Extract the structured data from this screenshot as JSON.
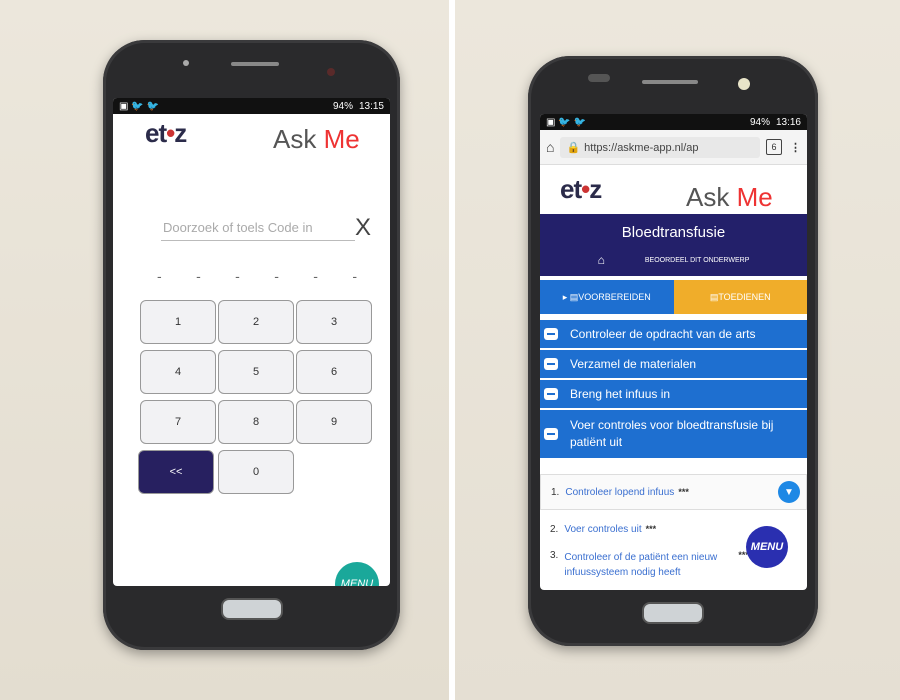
{
  "left_phone": {
    "status": {
      "icons": "▣ 🐦 🐦",
      "battery": "94%",
      "time": "13:15"
    },
    "logo": {
      "brand": "et",
      "brand_accent": "•",
      "brand_end": "z"
    },
    "askme": {
      "ask": "Ask ",
      "me": "Me"
    },
    "search": {
      "placeholder": "Doorzoek of toels Code in",
      "clear": "X"
    },
    "code_slots": [
      "-",
      "-",
      "-",
      "-",
      "-",
      "-"
    ],
    "keypad": {
      "k1": "1",
      "k2": "2",
      "k3": "3",
      "k4": "4",
      "k5": "5",
      "k6": "6",
      "k7": "7",
      "k8": "8",
      "k9": "9",
      "back": "<<",
      "k0": "0"
    },
    "menu_label": "MENU",
    "colors": {
      "accent": "#27206a",
      "fab": "#1aa89a"
    }
  },
  "right_phone": {
    "status": {
      "icons": "▣ 🐦 🐦",
      "battery": "94%",
      "time": "13:16"
    },
    "browser": {
      "url": "https://askme-app.nl/ap",
      "tabs_count": "6"
    },
    "logo": {
      "brand": "et",
      "brand_accent": "•",
      "brand_end": "z"
    },
    "askme": {
      "ask": "Ask ",
      "me": "Me"
    },
    "page_title": "Bloedtransfusie",
    "rate_label": "BEOORDEEL DIT ONDERWERP",
    "tabs": {
      "prepare": "VOORBEREIDEN",
      "administer": "TOEDIENEN"
    },
    "steps": [
      "Controleer de opdracht van de arts",
      "Verzamel de materialen",
      "Breng het infuus in",
      "Voer controles voor bloedtransfusie bij patiënt uit"
    ],
    "substeps": [
      {
        "num": "1.",
        "text": "Controleer lopend infuus",
        "more": "***"
      },
      {
        "num": "2.",
        "text": "Voer controles uit",
        "more": "***"
      },
      {
        "num": "3.",
        "text": "Controleer of de patiënt een nieuw infuussysteem nodig heeft",
        "more": "***"
      }
    ],
    "menu_label": "MENU",
    "colors": {
      "navy": "#23206a",
      "blue": "#1e6fd0",
      "orange": "#f0ad2a",
      "fab": "#2a2fb0"
    }
  }
}
